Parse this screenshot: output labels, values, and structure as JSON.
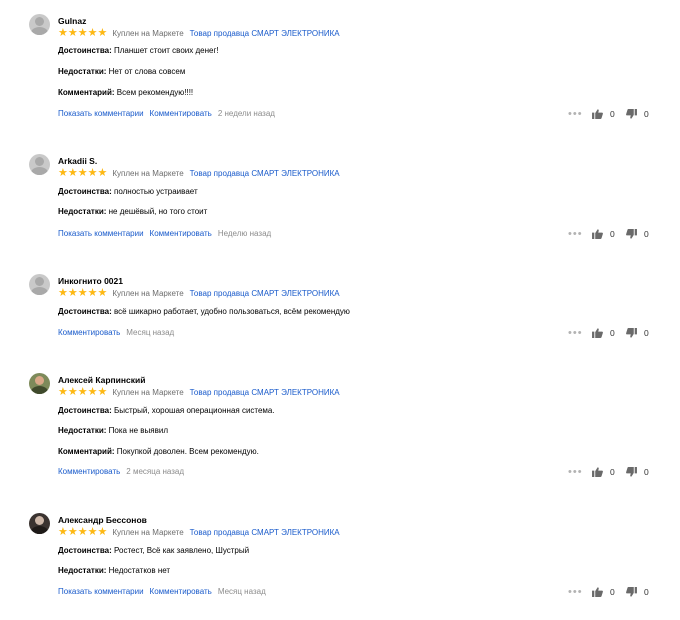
{
  "reviews": [
    {
      "name": "Gulnaz",
      "bought": "Куплен на Маркете",
      "seller": "Товар продавца СМАРТ ЭЛЕКТРОНИКА",
      "rating": 5,
      "fields": [
        {
          "label": "Достоинства:",
          "text": "Планшет стоит своих денег!"
        },
        {
          "label": "Недостатки:",
          "text": "Нет от слова совсем"
        },
        {
          "label": "Комментарий:",
          "text": "Всем рекомендую!!!!"
        }
      ],
      "show_comments": "Показать комментарии",
      "comment": "Комментировать",
      "date": "2 недели назад",
      "likes": "0",
      "dislikes": "0"
    },
    {
      "name": "Arkadii S.",
      "bought": "Куплен на Маркете",
      "seller": "Товар продавца СМАРТ ЭЛЕКТРОНИКА",
      "rating": 5,
      "fields": [
        {
          "label": "Достоинства:",
          "text": "полностью устраивает"
        },
        {
          "label": "Недостатки:",
          "text": "не дешёвый, но того стоит"
        }
      ],
      "show_comments": "Показать комментарии",
      "comment": "Комментировать",
      "date": "Неделю назад",
      "likes": "0",
      "dislikes": "0"
    },
    {
      "name": "Инкогнито 0021",
      "bought": "Куплен на Маркете",
      "seller": "Товар продавца СМАРТ ЭЛЕКТРОНИКА",
      "rating": 5,
      "fields": [
        {
          "label": "Достоинства:",
          "text": "всё шикарно работает, удобно пользоваться, всём рекомендую"
        }
      ],
      "comment": "Комментировать",
      "date": "Месяц назад",
      "likes": "0",
      "dislikes": "0"
    },
    {
      "name": "Алексей Карпинский",
      "bought": "Куплен на Маркете",
      "seller": "Товар продавца СМАРТ ЭЛЕКТРОНИКА",
      "rating": 5,
      "fields": [
        {
          "label": "Достоинства:",
          "text": "Быстрый, хорошая операционная система."
        },
        {
          "label": "Недостатки:",
          "text": "Пока не выявил"
        },
        {
          "label": "Комментарий:",
          "text": "Покупкой доволен. Всем рекомендую."
        }
      ],
      "comment": "Комментировать",
      "date": "2 месяца назад",
      "likes": "0",
      "dislikes": "0"
    },
    {
      "name": "Александр Бессонов",
      "bought": "Куплен на Маркете",
      "seller": "Товар продавца СМАРТ ЭЛЕКТРОНИКА",
      "rating": 5,
      "fields": [
        {
          "label": "Достоинства:",
          "text": "Ростест, Всё как заявлено, Шустрый"
        },
        {
          "label": "Недостатки:",
          "text": "Недостатков нет"
        }
      ],
      "show_comments": "Показать комментарии",
      "comment": "Комментировать",
      "date": "Месяц назад",
      "likes": "0",
      "dislikes": "0"
    }
  ],
  "colors": {
    "star": "#fdb813",
    "link": "#1a5bcb",
    "muted": "#8c8c8c"
  },
  "icons": {
    "more": "more-dots-icon",
    "like": "thumb-up-icon",
    "dislike": "thumb-down-icon"
  }
}
